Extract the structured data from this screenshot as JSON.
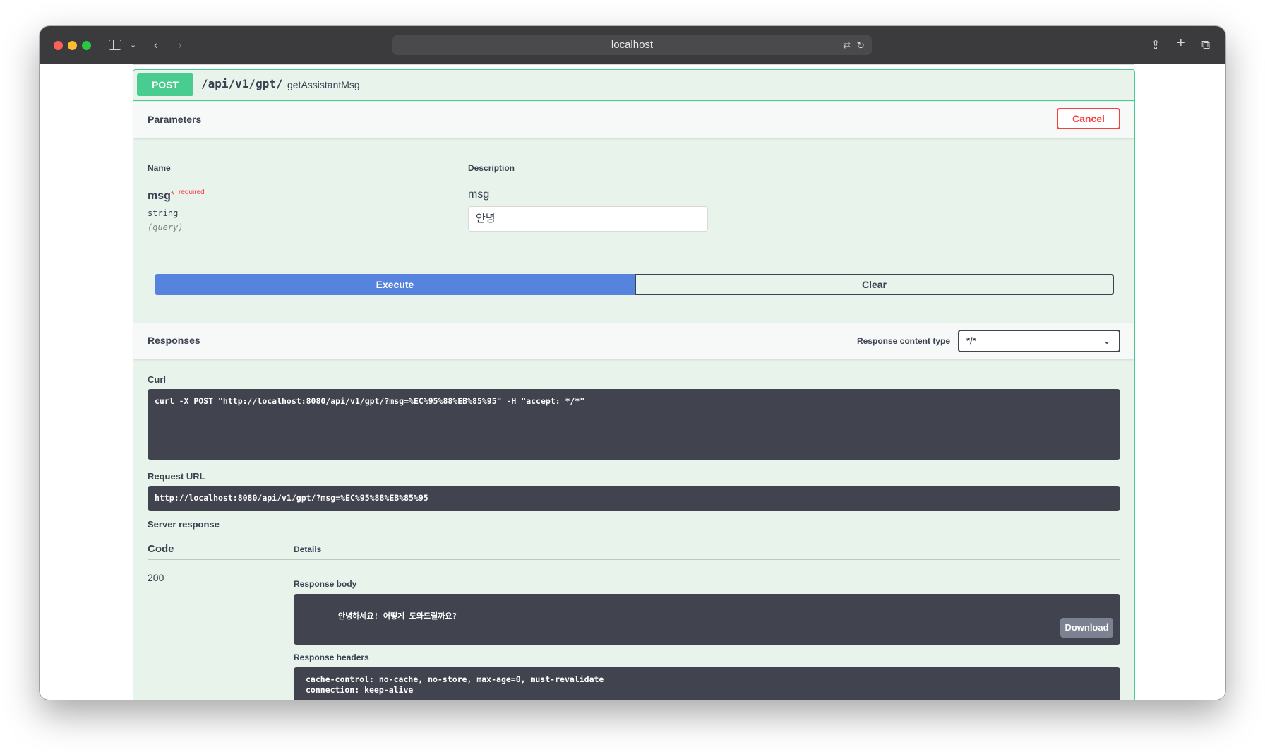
{
  "browser": {
    "address": "localhost"
  },
  "operation": {
    "method": "POST",
    "path": "/api/v1/gpt/",
    "summary": "getAssistantMsg",
    "method_color": "#49cc90"
  },
  "parameters": {
    "title": "Parameters",
    "cancel_label": "Cancel",
    "col_name": "Name",
    "col_description": "Description",
    "param": {
      "name": "msg",
      "star": "*",
      "required": "required",
      "type": "string",
      "in": "(query)",
      "description": "msg",
      "value": "안녕"
    }
  },
  "actions": {
    "execute": "Execute",
    "clear": "Clear"
  },
  "responses": {
    "title": "Responses",
    "content_type_label": "Response content type",
    "content_type_value": "*/*",
    "curl_label": "Curl",
    "curl": "curl -X POST \"http://localhost:8080/api/v1/gpt/?msg=%EC%95%88%EB%85%95\" -H \"accept: */*\"",
    "request_url_label": "Request URL",
    "request_url": "http://localhost:8080/api/v1/gpt/?msg=%EC%95%88%EB%85%95",
    "server_response_label": "Server response",
    "code_header": "Code",
    "details_header": "Details",
    "code": "200",
    "body_label": "Response body",
    "body": "안녕하세요! 어떻게 도와드릴까요?",
    "download_label": "Download",
    "headers_label": "Response headers",
    "headers_line1": "cache-control: no-cache, no-store, max-age=0, must-revalidate",
    "headers_line2": "connection: keep-alive"
  }
}
